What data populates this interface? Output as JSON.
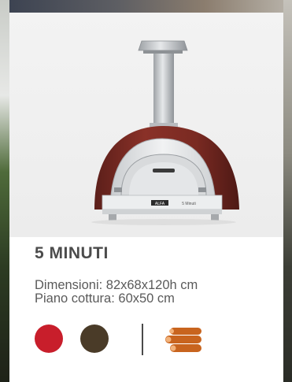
{
  "product": {
    "name": "5 MINUTI",
    "specs": [
      "Dimensioni: 82x68x120h cm",
      "Piano cottura: 60x50 cm"
    ],
    "oven_brand_plate": "ALFA",
    "oven_model_plate": "5 Minuti"
  },
  "colors": {
    "swatches": [
      {
        "name": "red",
        "hex": "#c81e2b"
      },
      {
        "name": "brown",
        "hex": "#4a3b28"
      }
    ],
    "oven_body": "#7d2a23",
    "fuel_icon": "#c8641e"
  },
  "icons": {
    "fuel": "wood-logs-icon"
  }
}
